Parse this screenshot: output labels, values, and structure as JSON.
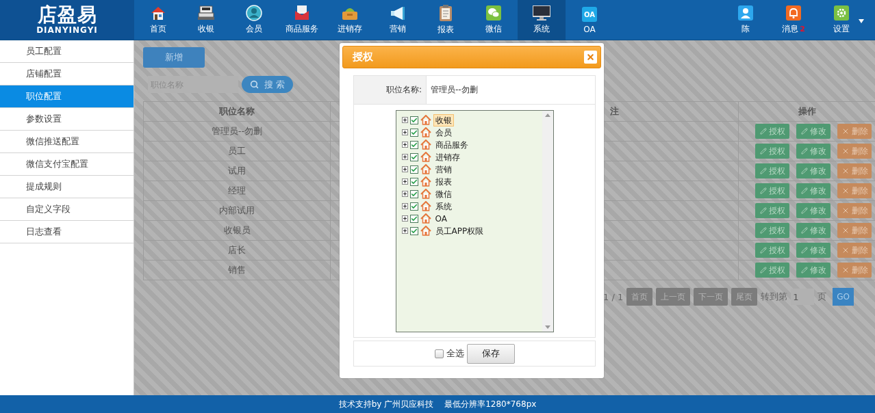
{
  "logo": {
    "title": "店盈易",
    "subtitle": "DIANYINGYI"
  },
  "nav": [
    {
      "label": "首页",
      "selected": false
    },
    {
      "label": "收银",
      "selected": false
    },
    {
      "label": "会员",
      "selected": false
    },
    {
      "label": "商品服务",
      "selected": false
    },
    {
      "label": "进销存",
      "selected": false
    },
    {
      "label": "营销",
      "selected": false
    },
    {
      "label": "报表",
      "selected": false
    },
    {
      "label": "微信",
      "selected": false
    },
    {
      "label": "系统",
      "selected": true
    },
    {
      "label": "OA",
      "selected": false,
      "icon_text": "OA"
    }
  ],
  "user_menu": [
    {
      "label": "陈"
    },
    {
      "label": "消息",
      "badge": "2"
    },
    {
      "label": "设置",
      "dropdown": true
    }
  ],
  "sidebar": [
    {
      "label": "员工配置",
      "selected": false
    },
    {
      "label": "店铺配置",
      "selected": false
    },
    {
      "label": "职位配置",
      "selected": true
    },
    {
      "label": "参数设置",
      "selected": false
    },
    {
      "label": "微信推送配置",
      "selected": false
    },
    {
      "label": "微信支付宝配置",
      "selected": false
    },
    {
      "label": "提成规则",
      "selected": false
    },
    {
      "label": "自定义字段",
      "selected": false
    },
    {
      "label": "日志查看",
      "selected": false
    }
  ],
  "add_button": "新增",
  "search": {
    "placeholder": "职位名称",
    "button": "搜 索"
  },
  "table": {
    "columns": [
      "职位名称",
      "注",
      "操作"
    ],
    "rows": [
      {
        "name": "管理员--勿删",
        "actions": [
          "授权",
          "修改",
          "删除"
        ]
      },
      {
        "name": "员工",
        "actions": [
          "授权",
          "修改",
          "删除"
        ]
      },
      {
        "name": "试用",
        "actions": [
          "授权",
          "修改",
          "删除"
        ]
      },
      {
        "name": "经理",
        "actions": [
          "授权",
          "修改",
          "删除"
        ]
      },
      {
        "name": "内部试用",
        "actions": [
          "授权",
          "修改",
          "删除"
        ]
      },
      {
        "name": "收银员",
        "actions": [
          "授权",
          "修改",
          "删除"
        ]
      },
      {
        "name": "店长",
        "actions": [
          "授权",
          "修改",
          "删除"
        ]
      },
      {
        "name": "销售",
        "actions": [
          "授权",
          "修改",
          "删除"
        ]
      }
    ]
  },
  "pagination": {
    "page": "1 / 1",
    "buttons": [
      "首页",
      "上一页",
      "下一页",
      "尾页"
    ],
    "goto_label": "转到第",
    "goto_value": "1",
    "unit": "页",
    "go": "GO"
  },
  "dialog": {
    "title": "授权",
    "field_label": "职位名称:",
    "field_value": "管理员--勿删",
    "tree": [
      {
        "label": "收银",
        "checked": true,
        "expanded": false,
        "selected": true
      },
      {
        "label": "会员",
        "checked": true,
        "expanded": false,
        "selected": false
      },
      {
        "label": "商品服务",
        "checked": true,
        "expanded": false,
        "selected": false
      },
      {
        "label": "进销存",
        "checked": true,
        "expanded": false,
        "selected": false
      },
      {
        "label": "营销",
        "checked": true,
        "expanded": false,
        "selected": false
      },
      {
        "label": "报表",
        "checked": true,
        "expanded": false,
        "selected": false
      },
      {
        "label": "微信",
        "checked": true,
        "expanded": false,
        "selected": false
      },
      {
        "label": "系统",
        "checked": true,
        "expanded": false,
        "selected": false
      },
      {
        "label": "OA",
        "checked": true,
        "expanded": false,
        "selected": false
      },
      {
        "label": "员工APP权限",
        "checked": true,
        "expanded": false,
        "selected": false
      }
    ],
    "select_all": {
      "label": "全选",
      "checked": false
    },
    "save": "保存"
  },
  "footer": {
    "support": "技术支持by 广州贝应科技",
    "resolution": "最低分辨率1280*768px"
  }
}
